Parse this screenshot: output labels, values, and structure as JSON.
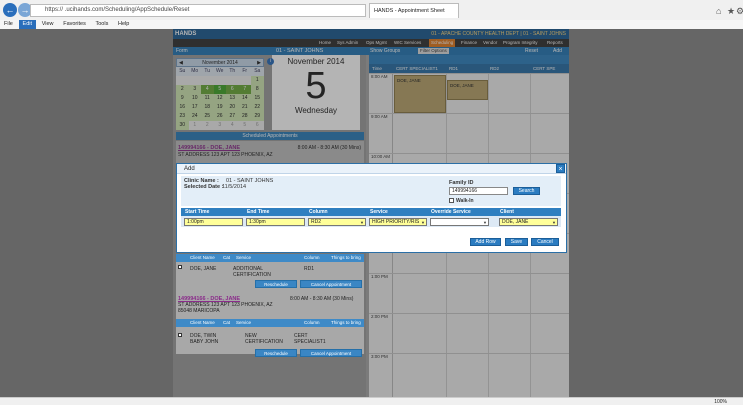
{
  "browser": {
    "address": "https://        .ucihands.com/Scheduling/AppSchedule/Reset",
    "tab_title": "HANDS - Appointment Sheet",
    "menu": [
      "File",
      "Edit",
      "View",
      "Favorites",
      "Tools",
      "Help"
    ],
    "zoom": "100%"
  },
  "app": {
    "banner_right": "01 - APACHE COUNTY HEALTH DEPT | 01 - SAINT JOHNS",
    "nav": [
      "Home",
      "Sys Admin",
      "Ops Mgmt",
      "WIC Services",
      "Scheduling",
      "Finance",
      "Vendor",
      "Program Integrity",
      "Reports"
    ],
    "subnav": {
      "form": "Form",
      "clinic": "01 - SAINT JOHNS",
      "show_groups": "Show Groups",
      "filter": "Filter Options",
      "reset": "Reset",
      "add": "Add"
    },
    "calendar": {
      "month": "November 2014",
      "days": [
        "Su",
        "Mo",
        "Tu",
        "We",
        "Th",
        "Fr",
        "Sa"
      ],
      "weeks": [
        [
          "",
          "",
          "",
          "",
          "",
          "",
          "1"
        ],
        [
          "2",
          "3",
          "4",
          "5",
          "6",
          "7",
          "8"
        ],
        [
          "9",
          "10",
          "11",
          "12",
          "13",
          "14",
          "15"
        ],
        [
          "16",
          "17",
          "18",
          "19",
          "20",
          "21",
          "22"
        ],
        [
          "23",
          "24",
          "25",
          "26",
          "27",
          "28",
          "29"
        ],
        [
          "30",
          "1",
          "2",
          "3",
          "4",
          "5",
          "6"
        ]
      ]
    },
    "big_date": {
      "month": "November 2014",
      "day": "5",
      "weekday": "Wednesday"
    },
    "scheduled_header": "Scheduled Appointments",
    "appointment1": {
      "id": "149994166 - DOE, JANE",
      "time": "8:00 AM - 8:30 AM (30 Mins)",
      "address": "ST ADDRESS 123 APT 123 PHOENIX, AZ",
      "city": "85048 MARICOPA"
    },
    "table_headers": {
      "client": "Client Name",
      "cat": "Cat",
      "service": "Service",
      "column": "Column",
      "things": "Things to bring"
    },
    "appt1_row": {
      "client": "DOE, JANE",
      "service": "ADDITIONAL CERTIFICATION",
      "column": "RD1"
    },
    "reschedule": "Reschedule",
    "cancel_appt": "Cancel Appointment",
    "appointment2": {
      "id": "149994166 - DOE, JANE",
      "time": "8:00 AM - 8:30 AM (30 Mins)",
      "address": "ST ADDRESS 123 APT 123 PHOENIX, AZ",
      "city": "85048 MARICOPA"
    },
    "appt2_row": {
      "client": "DOE, TWIN BABY JOHN",
      "service": "NEW CERTIFICATION",
      "column": "CERT SPECIALIST1"
    },
    "right": {
      "time_col": "Time",
      "cols": [
        "CERT SPECIALIST1",
        "RD1",
        "RD2",
        "CERT SPE"
      ],
      "times": [
        "8:00 AM",
        "9:00 AM",
        "10:00 AM",
        "11:00 AM",
        "12:00 PM",
        "1:00 PM",
        "2:00 PM",
        "3:00 PM"
      ],
      "block_label1": "DOE, JANE",
      "block_label2": "DOE, JANE"
    }
  },
  "dialog": {
    "title": "Add",
    "clinic_label": "Clinic Name :",
    "clinic_value": "01 - SAINT JOHNS",
    "date_label": "Selected Date :",
    "date_value": "11/5/2014",
    "family_label": "Family ID",
    "family_value": "149994166",
    "search": "Search",
    "walkin": "Walk-In",
    "columns": [
      "Start Time",
      "End Time",
      "Column",
      "Service",
      "Override Service",
      "Client"
    ],
    "row": {
      "start": "1:00pm",
      "end": "1:30pm",
      "column": "RD2",
      "service": "HIGH PRIORITY/RIS",
      "override": "",
      "client": "DOE, JANE"
    },
    "add_row": "Add Row",
    "save": "Save",
    "cancel": "Cancel"
  }
}
